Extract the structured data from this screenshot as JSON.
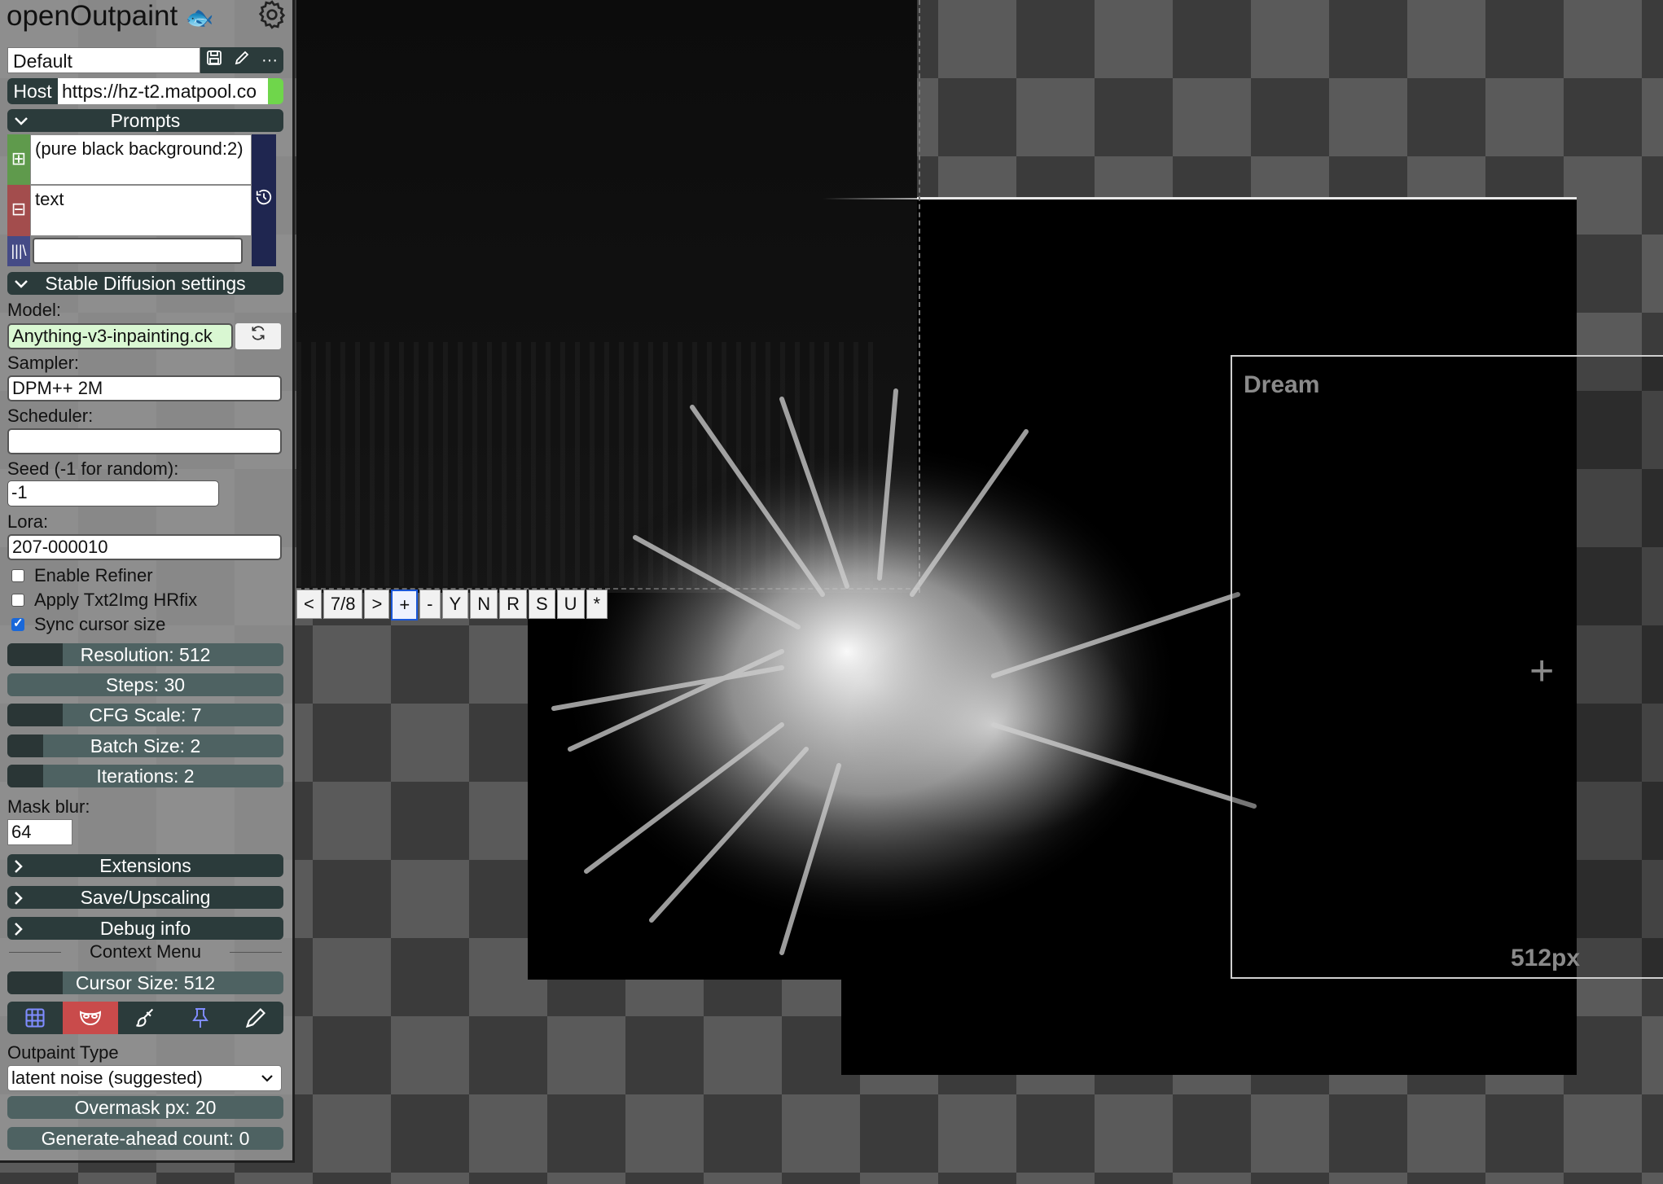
{
  "app": {
    "title": "openOutpaint"
  },
  "preset": {
    "value": "Default"
  },
  "host": {
    "label": "Host",
    "value": "https://hz-t2.matpool.co"
  },
  "sections": {
    "prompts": "Prompts",
    "sd_settings": "Stable Diffusion settings",
    "extensions": "Extensions",
    "save_upscaling": "Save/Upscaling",
    "debug": "Debug info"
  },
  "prompts": {
    "positive": "(pure black background:2)",
    "negative": "text",
    "style": ""
  },
  "settings": {
    "model_label": "Model:",
    "model_value": "Anything-v3-inpainting.ck",
    "sampler_label": "Sampler:",
    "sampler_value": "DPM++ 2M",
    "scheduler_label": "Scheduler:",
    "scheduler_value": "",
    "seed_label": "Seed (-1 for random):",
    "seed_value": "-1",
    "lora_label": "Lora:",
    "lora_value": "207-000010",
    "enable_refiner": {
      "label": "Enable Refiner",
      "checked": false
    },
    "hrfix": {
      "label": "Apply Txt2Img HRfix",
      "checked": false
    },
    "sync_cursor": {
      "label": "Sync cursor size",
      "checked": true
    }
  },
  "sliders": {
    "resolution": {
      "label": "Resolution: 512",
      "fill": 0.2
    },
    "steps": {
      "label": "Steps: 30",
      "fill": 0.0
    },
    "cfg": {
      "label": "CFG Scale: 7",
      "fill": 0.2
    },
    "batch": {
      "label": "Batch Size: 2",
      "fill": 0.13
    },
    "iterations": {
      "label": "Iterations: 2",
      "fill": 0.13
    },
    "cursor_size": {
      "label": "Cursor Size: 512",
      "fill": 0.2
    },
    "overmask": {
      "label": "Overmask px: 20",
      "fill": 0.0
    },
    "generate_ahead": {
      "label": "Generate-ahead count: 0",
      "fill": 0.0
    }
  },
  "mask_blur": {
    "label": "Mask blur:",
    "value": "64"
  },
  "context_menu": {
    "title": "Context Menu"
  },
  "tools": [
    "grid-icon",
    "mask-icon",
    "brush-icon",
    "pin-icon",
    "pencil-icon"
  ],
  "outpaint": {
    "label": "Outpaint Type",
    "value": "latent noise (suggested)"
  },
  "canvas": {
    "gen_bar": [
      "<",
      "7/8",
      ">",
      "+",
      "-",
      "Y",
      "N",
      "R",
      "S",
      "U",
      "*"
    ],
    "dream_label": "Dream",
    "dream_size": "512px"
  },
  "colors": {
    "panel_dark": "#2b3b3b",
    "host_status": "#6fd64b",
    "model_bg": "#d9f7d2",
    "positive_tag": "#5f9a4c",
    "negative_tag": "#a34d4d",
    "selected_tool": "#c94b4b"
  }
}
